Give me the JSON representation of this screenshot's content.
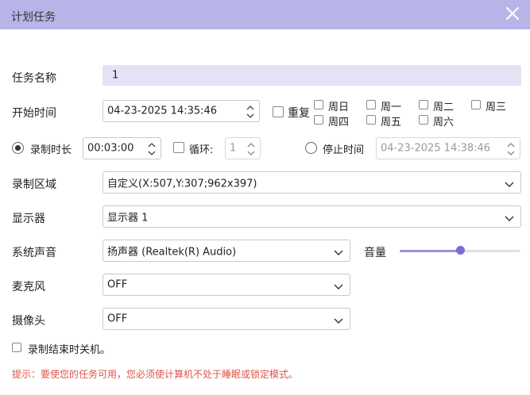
{
  "dialog": {
    "title": "计划任务"
  },
  "task_name": {
    "label": "任务名称",
    "value": "1"
  },
  "start_time": {
    "label": "开始时间",
    "value": "04-23-2025 14:35:46",
    "repeat_label": "重复",
    "repeat_checked": false,
    "weekdays": [
      "周日",
      "周一",
      "周二",
      "周三",
      "周四",
      "周五",
      "周六"
    ]
  },
  "record_duration": {
    "label": "录制时长",
    "selected": true,
    "value": "00:03:00",
    "loop_label": "循环:",
    "loop_checked": false,
    "loop_value": "1"
  },
  "stop_time": {
    "label": "停止时间",
    "selected": false,
    "value": "04-23-2025 14:38:46"
  },
  "record_area": {
    "label": "录制区域",
    "value": "自定义(X:507,Y:307;962x397)"
  },
  "display": {
    "label": "显示器",
    "value": "显示器 1"
  },
  "system_audio": {
    "label": "系统声音",
    "value": "扬声器 (Realtek(R) Audio)",
    "volume_label": "音量",
    "volume_level": 0.5
  },
  "microphone": {
    "label": "麦克风",
    "value": "OFF"
  },
  "camera": {
    "label": "摄像头",
    "value": "OFF"
  },
  "shutdown": {
    "label": "录制结束时关机。",
    "checked": false
  },
  "hint": "提示：要使您的任务可用，您必须使计算机不处于睡眠或锁定模式。",
  "colors": {
    "titlebar": "#b8b4e8",
    "accent": "#7a6cd6",
    "hint": "#e0534a"
  }
}
